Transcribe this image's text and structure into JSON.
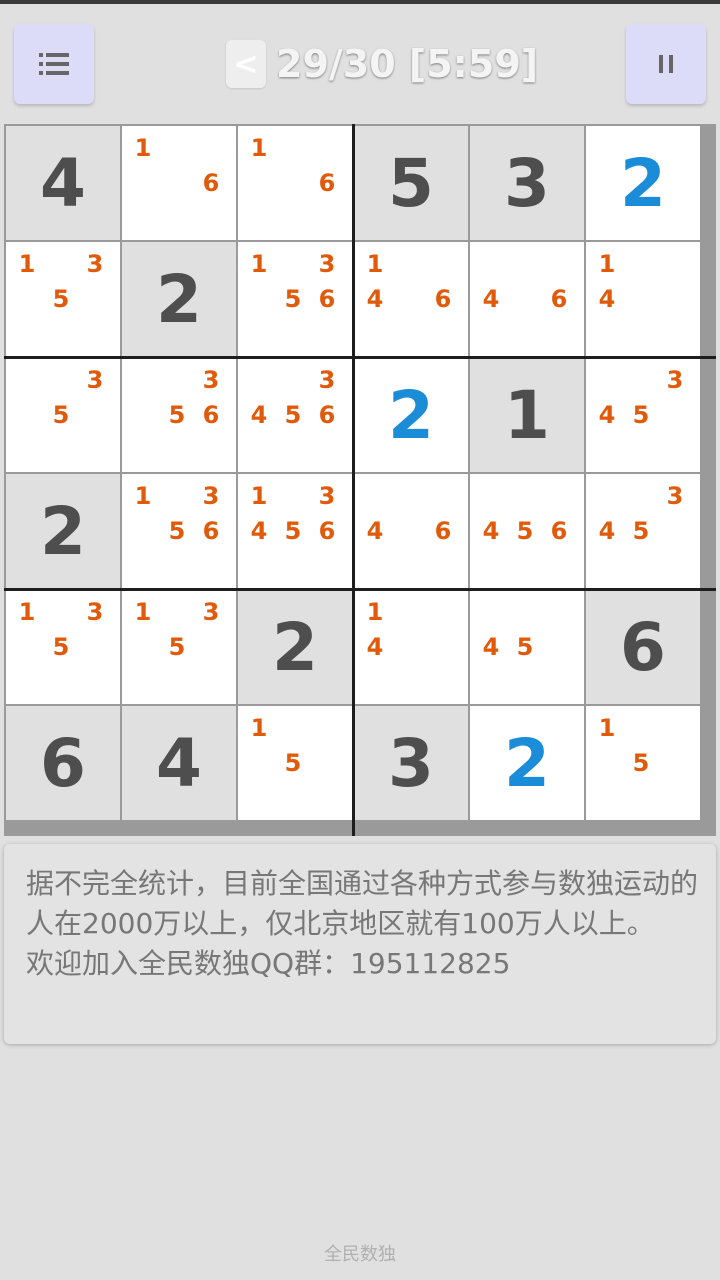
{
  "header": {
    "menu_icon": "list-menu-icon",
    "back_label": "<",
    "title": "29/30 [5:59]",
    "pause_icon": "pause-icon"
  },
  "board": {
    "rows": [
      [
        {
          "v": "4",
          "t": "given"
        },
        {
          "n": [
            "1",
            "6"
          ]
        },
        {
          "n": [
            "1",
            "6"
          ]
        },
        {
          "v": "5",
          "t": "given"
        },
        {
          "v": "3",
          "t": "given"
        },
        {
          "v": "2",
          "t": "user"
        }
      ],
      [
        {
          "n": [
            "1",
            "3",
            "5"
          ]
        },
        {
          "v": "2",
          "t": "given"
        },
        {
          "n": [
            "1",
            "3",
            "5",
            "6"
          ]
        },
        {
          "n": [
            "1",
            "4",
            "6"
          ]
        },
        {
          "n": [
            "4",
            "6"
          ]
        },
        {
          "n": [
            "1",
            "4"
          ]
        }
      ],
      [
        {
          "n": [
            "3",
            "5"
          ]
        },
        {
          "n": [
            "3",
            "5",
            "6"
          ]
        },
        {
          "n": [
            "3",
            "4",
            "5",
            "6"
          ]
        },
        {
          "v": "2",
          "t": "user"
        },
        {
          "v": "1",
          "t": "given"
        },
        {
          "n": [
            "3",
            "4",
            "5"
          ]
        }
      ],
      [
        {
          "v": "2",
          "t": "given"
        },
        {
          "n": [
            "1",
            "3",
            "5",
            "6"
          ]
        },
        {
          "n": [
            "1",
            "3",
            "4",
            "5",
            "6"
          ]
        },
        {
          "n": [
            "4",
            "6"
          ]
        },
        {
          "n": [
            "4",
            "5",
            "6"
          ]
        },
        {
          "n": [
            "3",
            "4",
            "5"
          ]
        }
      ],
      [
        {
          "n": [
            "1",
            "3",
            "5"
          ]
        },
        {
          "n": [
            "1",
            "3",
            "5"
          ]
        },
        {
          "v": "2",
          "t": "given"
        },
        {
          "n": [
            "1",
            "4"
          ]
        },
        {
          "n": [
            "4",
            "5"
          ]
        },
        {
          "v": "6",
          "t": "given"
        }
      ],
      [
        {
          "v": "6",
          "t": "given"
        },
        {
          "v": "4",
          "t": "given"
        },
        {
          "n": [
            "1",
            "5"
          ]
        },
        {
          "v": "3",
          "t": "given"
        },
        {
          "v": "2",
          "t": "user"
        },
        {
          "n": [
            "1",
            "5"
          ]
        }
      ]
    ]
  },
  "info": {
    "line1": "据不完全统计，目前全国通过各种方式参与数独运动的人在2000万以上，仅北京地区就有100万人以上。",
    "line2": "欢迎加入全民数独QQ群：195112825"
  },
  "footer": {
    "label": "全民数独"
  },
  "colors": {
    "given": "#4e4e4e",
    "user": "#1a8cd8",
    "note": "#e05a0a"
  }
}
